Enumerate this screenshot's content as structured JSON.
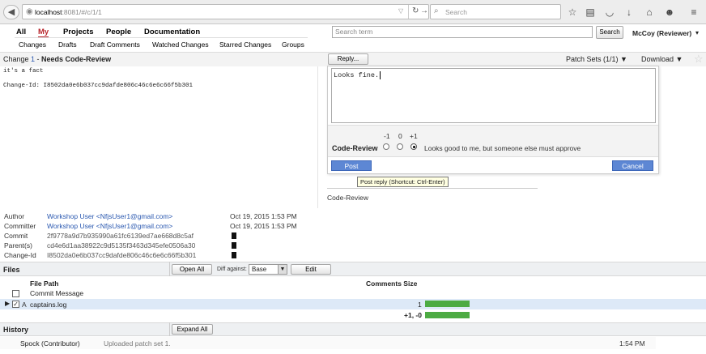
{
  "browser": {
    "url_host": "localhost",
    "url_rest": ":8081/#/c/1/1",
    "search_placeholder": "Search"
  },
  "topnav": {
    "tabs": [
      "All",
      "My",
      "Projects",
      "People",
      "Documentation"
    ],
    "active_tab": "My",
    "subtabs": [
      "Changes",
      "Drafts",
      "Draft Comments",
      "Watched Changes",
      "Starred Changes",
      "Groups"
    ],
    "search_placeholder": "Search term",
    "search_button": "Search",
    "user": "McCoy (Reviewer)",
    "user_caret": "▾"
  },
  "change": {
    "title_prefix": "Change ",
    "number": "1",
    "title_sep": " - ",
    "status": "Needs Code-Review",
    "reply_button": "Reply...",
    "patch_sets": "Patch Sets (1/1) ▼",
    "download": "Download ▼",
    "message_line1": "it's a fact",
    "message_line2": "Change-Id: I8502da0e6b037cc9dafde806c46c6e6c66f5b301"
  },
  "reply": {
    "text": "Looks fine.",
    "scale": [
      "-1",
      "0",
      "+1"
    ],
    "label": "Code-Review",
    "hint": "Looks good to me, but someone else must approve",
    "post_button": "Post",
    "cancel_button": "Cancel",
    "tooltip": "Post reply (Shortcut: Ctrl-Enter)",
    "under_label": "Code-Review"
  },
  "meta": {
    "author_label": "Author",
    "author": "Workshop User <NfjsUser1@gmail.com>",
    "author_date": "Oct 19, 2015 1:53 PM",
    "committer_label": "Committer",
    "committer": "Workshop User <NfjsUser1@gmail.com>",
    "committer_date": "Oct 19, 2015 1:53 PM",
    "commit_label": "Commit",
    "commit": "2f9778a9d7b935990a61fc6139ed7ae668d8c5af",
    "parent_label": "Parent(s)",
    "parent": "cd4e6d1aa38922c9d5135f3463d345efe0506a30",
    "changeid_label": "Change-Id",
    "changeid": "I8502da0e6b037cc9dafde806c46c6e6c66f5b301"
  },
  "files": {
    "title": "Files",
    "open_all": "Open All",
    "diff_against_label": "Diff against:",
    "diff_base": "Base",
    "edit_button": "Edit",
    "col_path": "File Path",
    "col_comments_size": "Comments Size",
    "rows": [
      {
        "status": "",
        "path": "Commit Message",
        "size": ""
      },
      {
        "status": "A",
        "path": "captains.log",
        "size": "1"
      }
    ],
    "total": "+1, -0",
    "accent": "#4dab43"
  },
  "history": {
    "title": "History",
    "expand_all": "Expand All",
    "author": "Spock (Contributor)",
    "message": "Uploaded patch set 1.",
    "time": "1:54 PM"
  }
}
